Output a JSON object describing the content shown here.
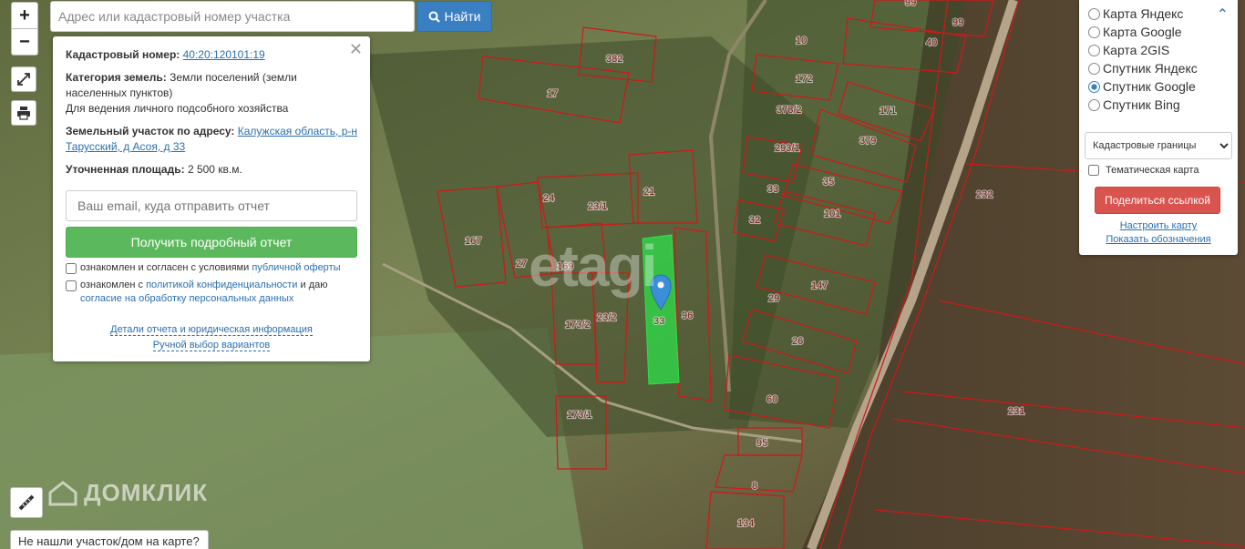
{
  "search": {
    "placeholder": "Адрес или кадастровый номер участка",
    "button_label": "Найти"
  },
  "controls": {
    "zoom_in": "+",
    "zoom_out": "−"
  },
  "info_panel": {
    "cadastral_label": "Кадастровый номер:",
    "cadastral_value": "40:20:120101:19",
    "category_label": "Категория земель:",
    "category_value": "Земли поселений (земли населенных пунктов)",
    "usage": "Для ведения личного подсобного хозяйства",
    "address_label": "Земельный участок по адресу:",
    "address_value": "Калужская область, р-н Тарусский, д Асоя, д 33",
    "area_label": "Уточненная площадь:",
    "area_value": "2 500 кв.м.",
    "email_placeholder": "Ваш email, куда отправить отчет",
    "report_button": "Получить подробный отчет",
    "consent1_text": "ознакомлен и согласен с условиями",
    "consent1_link": "публичной оферты",
    "consent2_text": "ознакомлен с",
    "consent2_link1": "политикой конфиденциальности",
    "consent2_mid": "и даю",
    "consent2_link2": "согласие на обработку персональных данных",
    "details_link": "Детали отчета и юридическая информация",
    "manual_link": "Ручной выбор вариантов"
  },
  "layer_panel": {
    "options": [
      {
        "label": "Карта Яндекс",
        "checked": false
      },
      {
        "label": "Карта Google",
        "checked": false
      },
      {
        "label": "Карта 2GIS",
        "checked": false
      },
      {
        "label": "Спутник Яндекс",
        "checked": false
      },
      {
        "label": "Спутник Google",
        "checked": true
      },
      {
        "label": "Спутник Bing",
        "checked": false
      }
    ],
    "select_value": "Кадастровые границы",
    "thematic_label": "Тематическая карта",
    "share_button": "Поделиться ссылкой",
    "configure_link": "Настроить карту",
    "legend_link": "Показать обозначения"
  },
  "not_found_button": "Не нашли участок/дом на карте?",
  "watermarks": {
    "domclick": "ДОМКЛИК",
    "etagi": "etagi"
  },
  "plot_labels": [
    "99",
    "99",
    "40",
    "10",
    "382",
    "17",
    "172",
    "378/2",
    "171",
    "379",
    "293/1",
    "35",
    "33",
    "101",
    "32",
    "24",
    "21",
    "23/1",
    "167",
    "27",
    "169",
    "147",
    "29",
    "96",
    "23/2",
    "173/2",
    "26",
    "60",
    "173/1",
    "95",
    "8",
    "134",
    "232",
    "231",
    "33"
  ],
  "colors": {
    "selected_plot": "#2ee04a",
    "boundary": "#d01818",
    "marker": "#3a8fd8"
  }
}
